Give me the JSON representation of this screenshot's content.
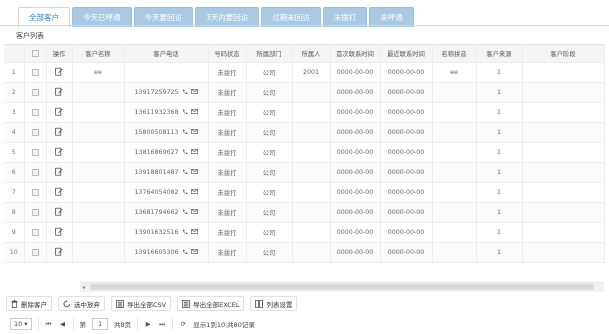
{
  "tabs": [
    {
      "label": "全部客户",
      "active": true
    },
    {
      "label": "今天已呼通",
      "active": false
    },
    {
      "label": "今天要回访",
      "active": false
    },
    {
      "label": "3天内要回访",
      "active": false
    },
    {
      "label": "过期未回访",
      "active": false
    },
    {
      "label": "未拨打",
      "active": false
    },
    {
      "label": "未呼通",
      "active": false
    }
  ],
  "list_title": "客户列表",
  "table": {
    "columns": [
      "",
      "",
      "操作",
      "客户名称",
      "客户电话",
      "号码状态",
      "所属部门",
      "所属人",
      "首次联系时间",
      "最近联系时间",
      "名称拼音",
      "客户来源",
      "客户阶段"
    ],
    "rows": [
      {
        "num": "1",
        "name": "ee",
        "phone": "",
        "status": "未拨打",
        "dept": "公司",
        "owner": "2001",
        "first": "0000-00-00",
        "last": "0000-00-00",
        "pinyin": "ee",
        "source": "1",
        "stage": ""
      },
      {
        "num": "2",
        "name": "",
        "phone": "13917259725",
        "status": "未拨打",
        "dept": "公司",
        "owner": "",
        "first": "0000-00-00",
        "last": "0000-00-00",
        "pinyin": "",
        "source": "1",
        "stage": ""
      },
      {
        "num": "3",
        "name": "",
        "phone": "13611932368",
        "status": "未拨打",
        "dept": "公司",
        "owner": "",
        "first": "0000-00-00",
        "last": "0000-00-00",
        "pinyin": "",
        "source": "1",
        "stage": ""
      },
      {
        "num": "4",
        "name": "",
        "phone": "15800508113",
        "status": "未拨打",
        "dept": "公司",
        "owner": "",
        "first": "0000-00-00",
        "last": "0000-00-00",
        "pinyin": "",
        "source": "1",
        "stage": ""
      },
      {
        "num": "5",
        "name": "",
        "phone": "13816869627",
        "status": "未拨打",
        "dept": "公司",
        "owner": "",
        "first": "0000-00-00",
        "last": "0000-00-00",
        "pinyin": "",
        "source": "1",
        "stage": ""
      },
      {
        "num": "6",
        "name": "",
        "phone": "13918801487",
        "status": "未拨打",
        "dept": "公司",
        "owner": "",
        "first": "0000-00-00",
        "last": "0000-00-00",
        "pinyin": "",
        "source": "1",
        "stage": ""
      },
      {
        "num": "7",
        "name": "",
        "phone": "13764054082",
        "status": "未拨打",
        "dept": "公司",
        "owner": "",
        "first": "0000-00-00",
        "last": "0000-00-00",
        "pinyin": "",
        "source": "1",
        "stage": ""
      },
      {
        "num": "8",
        "name": "",
        "phone": "13681794662",
        "status": "未拨打",
        "dept": "公司",
        "owner": "",
        "first": "0000-00-00",
        "last": "0000-00-00",
        "pinyin": "",
        "source": "1",
        "stage": ""
      },
      {
        "num": "9",
        "name": "",
        "phone": "13901632516",
        "status": "未拨打",
        "dept": "公司",
        "owner": "",
        "first": "0000-00-00",
        "last": "0000-00-00",
        "pinyin": "",
        "source": "1",
        "stage": ""
      },
      {
        "num": "10",
        "name": "",
        "phone": "13916605306",
        "status": "未拨打",
        "dept": "公司",
        "owner": "",
        "first": "0000-00-00",
        "last": "0000-00-00",
        "pinyin": "",
        "source": "1",
        "stage": ""
      }
    ]
  },
  "toolbar": {
    "delete_label": "删除客户",
    "discard_label": "选中放弃",
    "export_csv_label": "导出全部CSV",
    "export_excel_label": "导出全部EXCEL",
    "columns_label": "列表设置"
  },
  "pager": {
    "page_size": "10",
    "page_label": "第",
    "page_value": "1",
    "total_pages": "共8页",
    "summary": "显示1到10,共80记录"
  },
  "icons": {
    "edit": "edit-icon",
    "phone": "phone-icon",
    "mail": "mail-icon",
    "delete": "trash-icon",
    "discard": "undo-icon",
    "export": "export-icon",
    "columns": "columns-icon",
    "refresh": "refresh-icon"
  },
  "colors": {
    "tab_active_text": "#2f7ec2",
    "tab_inactive_bg": "#a9c9e4"
  }
}
